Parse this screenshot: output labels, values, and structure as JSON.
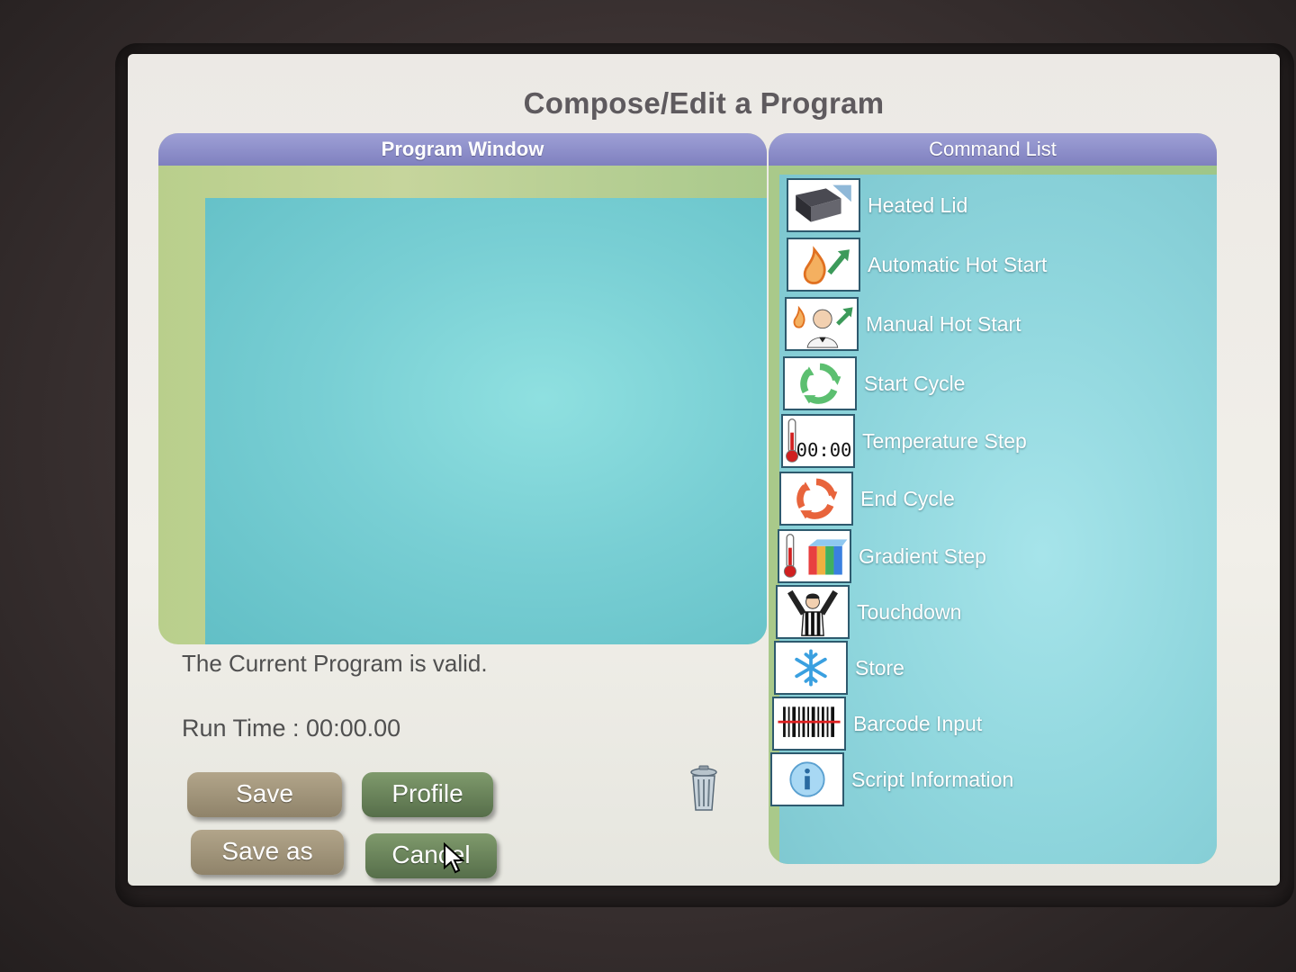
{
  "screen": {
    "title": "Compose/Edit a Program"
  },
  "program_window": {
    "header": "Program Window",
    "status_text": "The Current Program is valid.",
    "run_time": "Run Time : 00:00.00"
  },
  "buttons": {
    "save": "Save",
    "profile": "Profile",
    "save_as": "Save as",
    "cancel": "Cancel"
  },
  "command_list": {
    "header": "Command List",
    "items": [
      {
        "label": "Heated Lid",
        "icon": "heated-lid-icon"
      },
      {
        "label": "Automatic Hot Start",
        "icon": "automatic-hot-start-icon"
      },
      {
        "label": "Manual Hot Start",
        "icon": "manual-hot-start-icon"
      },
      {
        "label": "Start Cycle",
        "icon": "start-cycle-icon"
      },
      {
        "label": "Temperature Step",
        "icon": "temperature-step-icon"
      },
      {
        "label": "End Cycle",
        "icon": "end-cycle-icon"
      },
      {
        "label": "Gradient Step",
        "icon": "gradient-step-icon"
      },
      {
        "label": "Touchdown",
        "icon": "touchdown-icon"
      },
      {
        "label": "Store",
        "icon": "store-snowflake-icon"
      },
      {
        "label": "Barcode Input",
        "icon": "barcode-icon"
      },
      {
        "label": "Script Information",
        "icon": "info-icon"
      }
    ],
    "temperature_step_icon_text": "00:00"
  },
  "colors": {
    "header_purple": "#8889c8",
    "panel_green": "#b9cf8c",
    "program_area_cyan": "#79cfd4",
    "button_tan": "#a0947a",
    "button_green": "#6a8458"
  }
}
